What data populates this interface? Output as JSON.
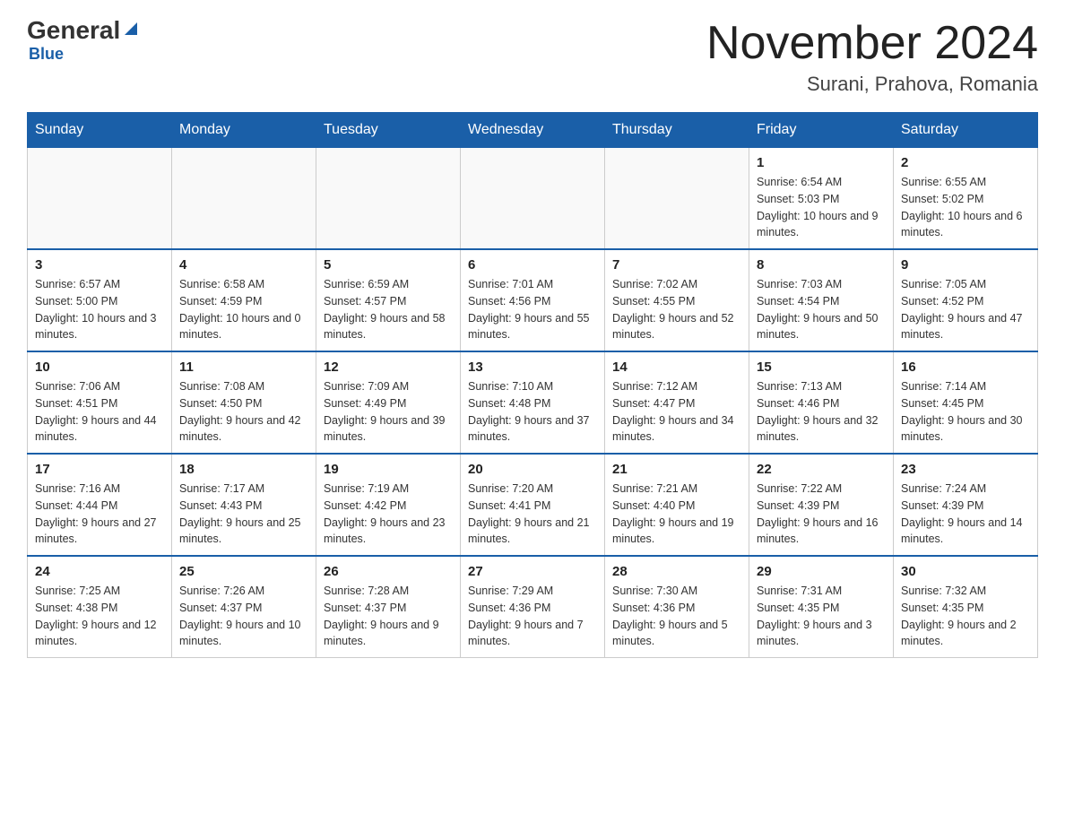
{
  "logo": {
    "general": "General",
    "blue": "Blue"
  },
  "title": "November 2024",
  "subtitle": "Surani, Prahova, Romania",
  "days_header": [
    "Sunday",
    "Monday",
    "Tuesday",
    "Wednesday",
    "Thursday",
    "Friday",
    "Saturday"
  ],
  "weeks": [
    [
      {
        "day": "",
        "info": ""
      },
      {
        "day": "",
        "info": ""
      },
      {
        "day": "",
        "info": ""
      },
      {
        "day": "",
        "info": ""
      },
      {
        "day": "",
        "info": ""
      },
      {
        "day": "1",
        "info": "Sunrise: 6:54 AM\nSunset: 5:03 PM\nDaylight: 10 hours and 9 minutes."
      },
      {
        "day": "2",
        "info": "Sunrise: 6:55 AM\nSunset: 5:02 PM\nDaylight: 10 hours and 6 minutes."
      }
    ],
    [
      {
        "day": "3",
        "info": "Sunrise: 6:57 AM\nSunset: 5:00 PM\nDaylight: 10 hours and 3 minutes."
      },
      {
        "day": "4",
        "info": "Sunrise: 6:58 AM\nSunset: 4:59 PM\nDaylight: 10 hours and 0 minutes."
      },
      {
        "day": "5",
        "info": "Sunrise: 6:59 AM\nSunset: 4:57 PM\nDaylight: 9 hours and 58 minutes."
      },
      {
        "day": "6",
        "info": "Sunrise: 7:01 AM\nSunset: 4:56 PM\nDaylight: 9 hours and 55 minutes."
      },
      {
        "day": "7",
        "info": "Sunrise: 7:02 AM\nSunset: 4:55 PM\nDaylight: 9 hours and 52 minutes."
      },
      {
        "day": "8",
        "info": "Sunrise: 7:03 AM\nSunset: 4:54 PM\nDaylight: 9 hours and 50 minutes."
      },
      {
        "day": "9",
        "info": "Sunrise: 7:05 AM\nSunset: 4:52 PM\nDaylight: 9 hours and 47 minutes."
      }
    ],
    [
      {
        "day": "10",
        "info": "Sunrise: 7:06 AM\nSunset: 4:51 PM\nDaylight: 9 hours and 44 minutes."
      },
      {
        "day": "11",
        "info": "Sunrise: 7:08 AM\nSunset: 4:50 PM\nDaylight: 9 hours and 42 minutes."
      },
      {
        "day": "12",
        "info": "Sunrise: 7:09 AM\nSunset: 4:49 PM\nDaylight: 9 hours and 39 minutes."
      },
      {
        "day": "13",
        "info": "Sunrise: 7:10 AM\nSunset: 4:48 PM\nDaylight: 9 hours and 37 minutes."
      },
      {
        "day": "14",
        "info": "Sunrise: 7:12 AM\nSunset: 4:47 PM\nDaylight: 9 hours and 34 minutes."
      },
      {
        "day": "15",
        "info": "Sunrise: 7:13 AM\nSunset: 4:46 PM\nDaylight: 9 hours and 32 minutes."
      },
      {
        "day": "16",
        "info": "Sunrise: 7:14 AM\nSunset: 4:45 PM\nDaylight: 9 hours and 30 minutes."
      }
    ],
    [
      {
        "day": "17",
        "info": "Sunrise: 7:16 AM\nSunset: 4:44 PM\nDaylight: 9 hours and 27 minutes."
      },
      {
        "day": "18",
        "info": "Sunrise: 7:17 AM\nSunset: 4:43 PM\nDaylight: 9 hours and 25 minutes."
      },
      {
        "day": "19",
        "info": "Sunrise: 7:19 AM\nSunset: 4:42 PM\nDaylight: 9 hours and 23 minutes."
      },
      {
        "day": "20",
        "info": "Sunrise: 7:20 AM\nSunset: 4:41 PM\nDaylight: 9 hours and 21 minutes."
      },
      {
        "day": "21",
        "info": "Sunrise: 7:21 AM\nSunset: 4:40 PM\nDaylight: 9 hours and 19 minutes."
      },
      {
        "day": "22",
        "info": "Sunrise: 7:22 AM\nSunset: 4:39 PM\nDaylight: 9 hours and 16 minutes."
      },
      {
        "day": "23",
        "info": "Sunrise: 7:24 AM\nSunset: 4:39 PM\nDaylight: 9 hours and 14 minutes."
      }
    ],
    [
      {
        "day": "24",
        "info": "Sunrise: 7:25 AM\nSunset: 4:38 PM\nDaylight: 9 hours and 12 minutes."
      },
      {
        "day": "25",
        "info": "Sunrise: 7:26 AM\nSunset: 4:37 PM\nDaylight: 9 hours and 10 minutes."
      },
      {
        "day": "26",
        "info": "Sunrise: 7:28 AM\nSunset: 4:37 PM\nDaylight: 9 hours and 9 minutes."
      },
      {
        "day": "27",
        "info": "Sunrise: 7:29 AM\nSunset: 4:36 PM\nDaylight: 9 hours and 7 minutes."
      },
      {
        "day": "28",
        "info": "Sunrise: 7:30 AM\nSunset: 4:36 PM\nDaylight: 9 hours and 5 minutes."
      },
      {
        "day": "29",
        "info": "Sunrise: 7:31 AM\nSunset: 4:35 PM\nDaylight: 9 hours and 3 minutes."
      },
      {
        "day": "30",
        "info": "Sunrise: 7:32 AM\nSunset: 4:35 PM\nDaylight: 9 hours and 2 minutes."
      }
    ]
  ]
}
